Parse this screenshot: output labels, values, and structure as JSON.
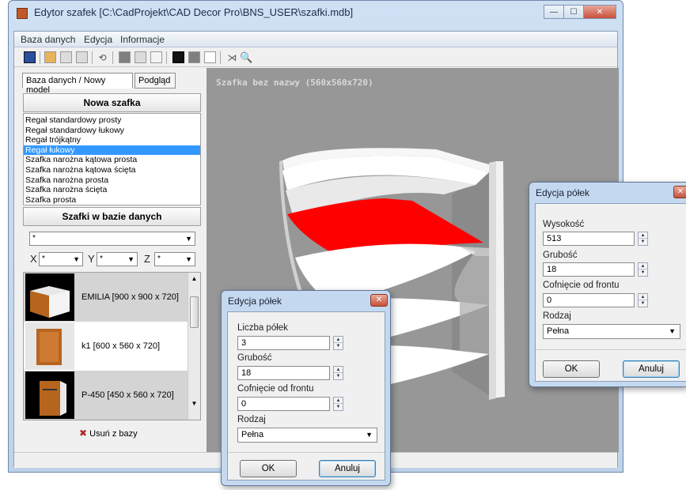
{
  "window": {
    "title": "Edytor szafek [C:\\CadProjekt\\CAD Decor Pro\\BNS_USER\\szafki.mdb]",
    "buttons": {
      "minimize": "—",
      "maximize": "☐",
      "close": "✕"
    }
  },
  "menu": [
    "Baza danych",
    "Edycja",
    "Informacje"
  ],
  "toolbar": {
    "undo_icon": "⟲",
    "mirror_icon": "⋊",
    "zoom_icon": "🔍"
  },
  "left_panel": {
    "tabs": [
      "Baza danych / Nowy model",
      "Podgląd"
    ],
    "new_cabinet_header": "Nowa szafka",
    "cabinet_types": [
      "Regał standardowy prosty",
      "Regał standardowy łukowy",
      "Regał trójkątny",
      "Regał łukowy",
      "Szafka narożna kątowa prosta",
      "Szafka narożna kątowa ścięta",
      "Szafka narożna prosta",
      "Szafka narożna ścięta",
      "Szafka prosta"
    ],
    "selected_type_index": 3,
    "db_header": "Szafki w bazie danych",
    "filter_main": "*",
    "filter_x_label": "X",
    "filter_x": "*",
    "filter_y_label": "Y",
    "filter_y": "*",
    "filter_z_label": "Z",
    "filter_z": "*",
    "cabinets": [
      {
        "name": "EMILIA  [900 x 900 x 720]"
      },
      {
        "name": "k1  [600 x 560 x 720]"
      },
      {
        "name": "P-450  [450 x 560 x 720]"
      }
    ],
    "delete_label": "Usuń z bazy"
  },
  "viewport": {
    "title": "Szafka bez nazwy (560x560x720)",
    "highlight_color": "#ff0000"
  },
  "dialog_left": {
    "title": "Edycja półek",
    "count_label": "Liczba półek",
    "count_value": "3",
    "thickness_label": "Grubość",
    "thickness_value": "18",
    "setback_label": "Cofnięcie od frontu",
    "setback_value": "0",
    "type_label": "Rodzaj",
    "type_value": "Pełna",
    "ok_label": "OK",
    "cancel_label": "Anuluj"
  },
  "dialog_right": {
    "title": "Edycja półek",
    "height_label": "Wysokość",
    "height_value": "513",
    "thickness_label": "Grubość",
    "thickness_value": "18",
    "setback_label": "Cofnięcie od frontu",
    "setback_value": "0",
    "type_label": "Rodzaj",
    "type_value": "Pełna",
    "ok_label": "OK",
    "cancel_label": "Anuluj"
  }
}
